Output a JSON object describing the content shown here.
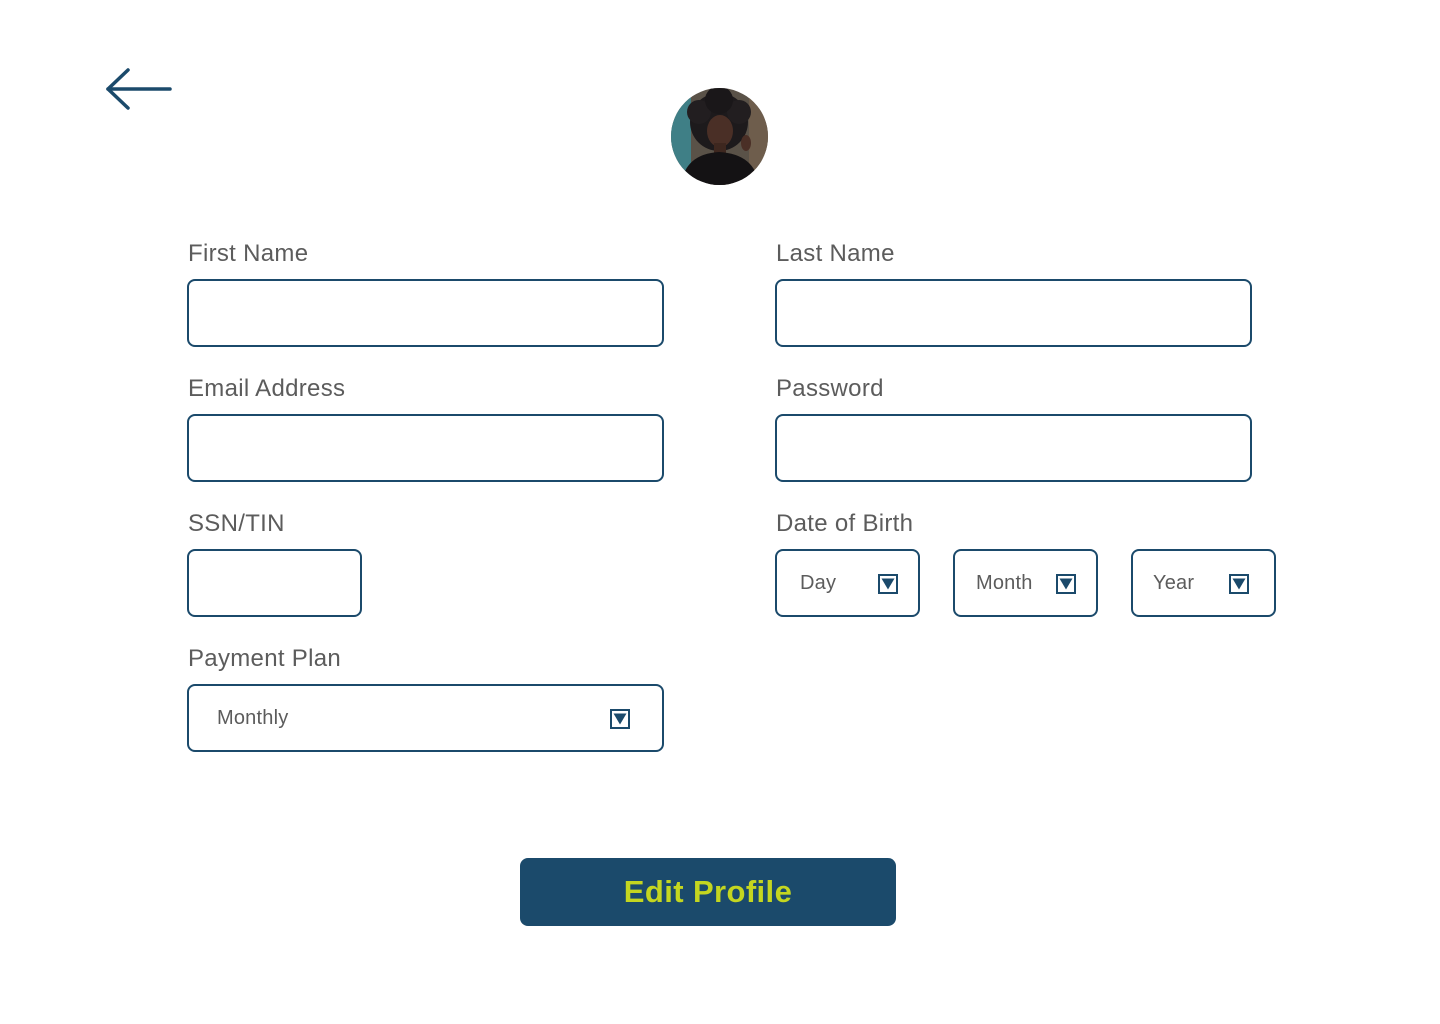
{
  "navigation": {
    "back_icon": "arrow-left-icon"
  },
  "profile": {
    "avatar_icon": "user-avatar-photo"
  },
  "form": {
    "first_name": {
      "label": "First Name",
      "value": "",
      "placeholder": ""
    },
    "last_name": {
      "label": "Last Name",
      "value": "",
      "placeholder": ""
    },
    "email": {
      "label": "Email Address",
      "value": "",
      "placeholder": ""
    },
    "password": {
      "label": "Password",
      "value": "",
      "placeholder": ""
    },
    "ssn": {
      "label": "SSN/TIN",
      "value": "",
      "placeholder": ""
    },
    "date_of_birth": {
      "label": "Date of Birth",
      "day": "Day",
      "month": "Month",
      "year": "Year"
    },
    "payment_plan": {
      "label": "Payment Plan",
      "selected": "Monthly"
    },
    "submit_label": "Edit Profile"
  },
  "colors": {
    "primary": "#1b4a6b",
    "accent": "#c4d620",
    "label_text": "#5c5c5c",
    "background": "#ffffff"
  }
}
